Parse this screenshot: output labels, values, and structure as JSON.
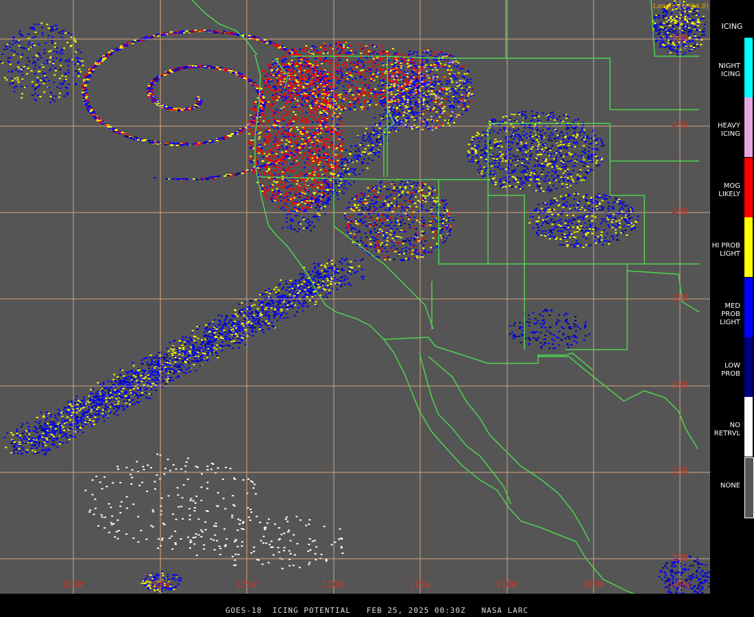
{
  "product": {
    "credit": "Langley (M04.0)",
    "caption": "GOES-18  ICING POTENTIAL   FEB 25, 2025 00:30Z   NASA LARC"
  },
  "map": {
    "background": "#555555",
    "grid_color": "#d9a77f",
    "boundary_color": "#4fd44f",
    "lat_labels": [
      "50N",
      "45N",
      "40N",
      "35N",
      "30N",
      "25N",
      "20N"
    ],
    "lon_labels": [
      "135W",
      "130W",
      "125W",
      "120W",
      "115W",
      "110W",
      "105W",
      "100W"
    ]
  },
  "legend": {
    "title": "ICING",
    "items": [
      {
        "label": "NIGHT ICING",
        "color": "#00ffff"
      },
      {
        "label": "HEAVY ICING",
        "color": "#e8a6e0"
      },
      {
        "label": "MOG LIKELY",
        "color": "#ff0000"
      },
      {
        "label": "HI PROB LIGHT",
        "color": "#ffff00"
      },
      {
        "label": "MED PROB LIGHT",
        "color": "#0000ff"
      },
      {
        "label": "LOW PROB",
        "color": "#000080"
      },
      {
        "label": "NO RETRVL",
        "color": "#ffffff"
      },
      {
        "label": "NONE",
        "color": "#555555"
      }
    ]
  }
}
